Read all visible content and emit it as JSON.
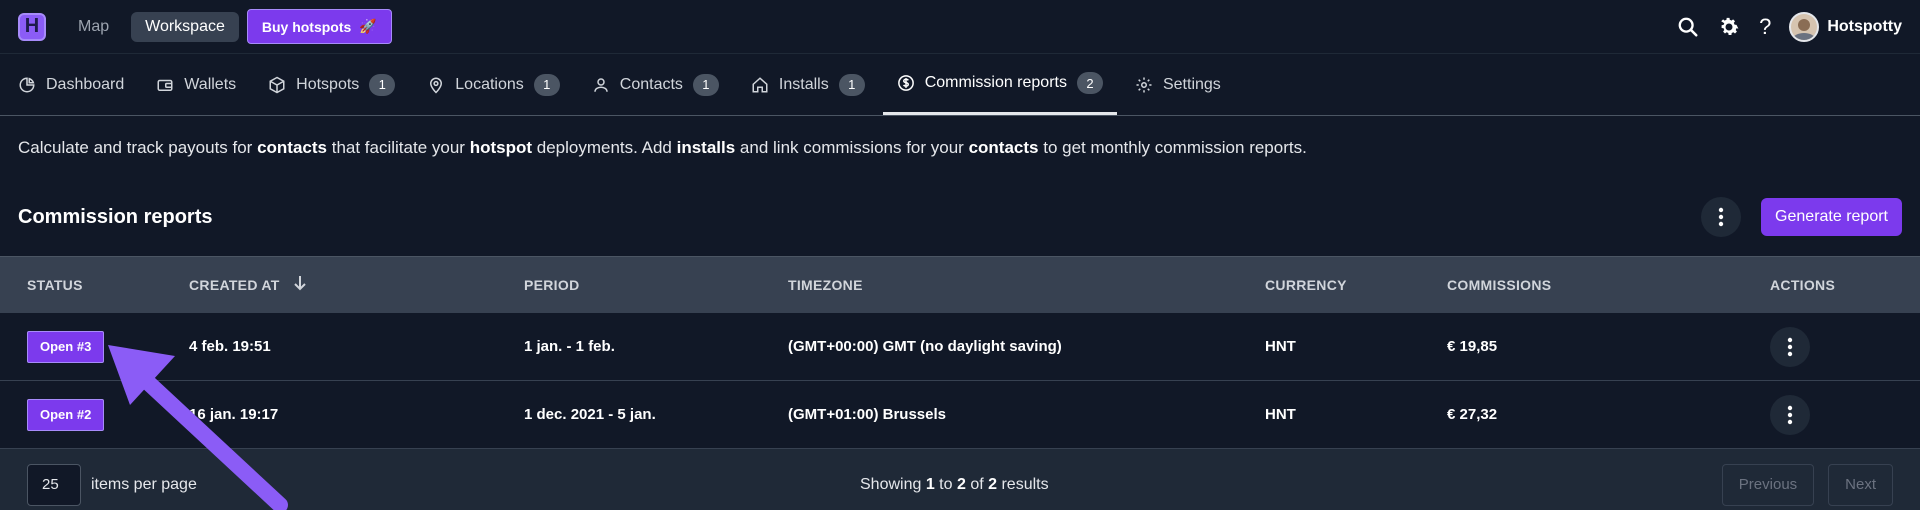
{
  "topbar": {
    "logo_letter": "H",
    "nav": [
      {
        "label": "Map",
        "active": false
      },
      {
        "label": "Workspace",
        "active": true
      }
    ],
    "buy_label": "Buy hotspots",
    "buy_emoji": "🚀",
    "help_label": "?",
    "user_name": "Hotspotty"
  },
  "tabs": [
    {
      "label": "Dashboard",
      "icon": "pie-chart-icon",
      "badge": null,
      "active": false
    },
    {
      "label": "Wallets",
      "icon": "wallet-icon",
      "badge": null,
      "active": false
    },
    {
      "label": "Hotspots",
      "icon": "cube-icon",
      "badge": "1",
      "active": false
    },
    {
      "label": "Locations",
      "icon": "location-pin-icon",
      "badge": "1",
      "active": false
    },
    {
      "label": "Contacts",
      "icon": "person-icon",
      "badge": "1",
      "active": false
    },
    {
      "label": "Installs",
      "icon": "home-icon",
      "badge": "1",
      "active": false
    },
    {
      "label": "Commission reports",
      "icon": "dollar-circle-icon",
      "badge": "2",
      "active": true
    },
    {
      "label": "Settings",
      "icon": "gear-icon",
      "badge": null,
      "active": false
    }
  ],
  "description": {
    "p1": "Calculate and track payouts for ",
    "b1": "contacts",
    "p2": " that facilitate your ",
    "b2": "hotspot",
    "p3": " deployments. Add ",
    "b3": "installs",
    "p4": " and link commissions for your ",
    "b4": "contacts",
    "p5": " to get monthly commission reports."
  },
  "section": {
    "title": "Commission reports",
    "generate_label": "Generate report"
  },
  "table": {
    "headers": {
      "status": "STATUS",
      "created": "CREATED AT",
      "period": "PERIOD",
      "timezone": "TIMEZONE",
      "currency": "CURRENCY",
      "commissions": "COMMISSIONS",
      "actions": "ACTIONS"
    },
    "rows": [
      {
        "status": "Open #3",
        "created": "4 feb. 19:51",
        "period": "1 jan. - 1 feb.",
        "timezone": "(GMT+00:00) GMT (no daylight saving)",
        "currency": "HNT",
        "commissions": "€ 19,85"
      },
      {
        "status": "Open #2",
        "created": "16 jan. 19:17",
        "period": "1 dec. 2021 - 5 jan.",
        "timezone": "(GMT+01:00) Brussels",
        "currency": "HNT",
        "commissions": "€ 27,32"
      }
    ]
  },
  "pager": {
    "per_page": "25",
    "per_page_label": "items per page",
    "showing_prefix": "Showing ",
    "from": "1",
    "to_word": " to ",
    "to": "2",
    "of_word": " of ",
    "total": "2",
    "results_word": " results",
    "previous": "Previous",
    "next": "Next"
  },
  "colors": {
    "background": "#111827",
    "accent": "#7c3aed",
    "annotation_arrow": "#8b5cf6"
  }
}
